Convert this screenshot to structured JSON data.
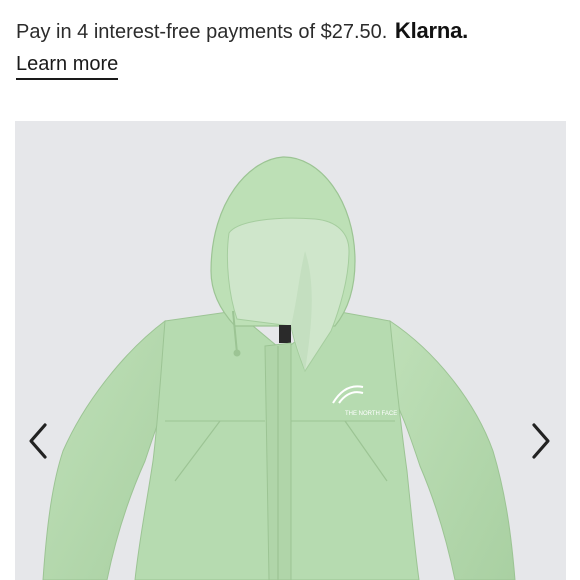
{
  "promo": {
    "message": "Pay in 4 interest-free payments of $27.50.",
    "brand": "Klarna.",
    "learn_more": "Learn more"
  },
  "gallery": {
    "prev_icon": "chevron-left-icon",
    "next_icon": "chevron-right-icon",
    "product_color": "#b3d8ac",
    "background_color": "#e6e7ea",
    "logo_text": "THE NORTH FACE"
  }
}
